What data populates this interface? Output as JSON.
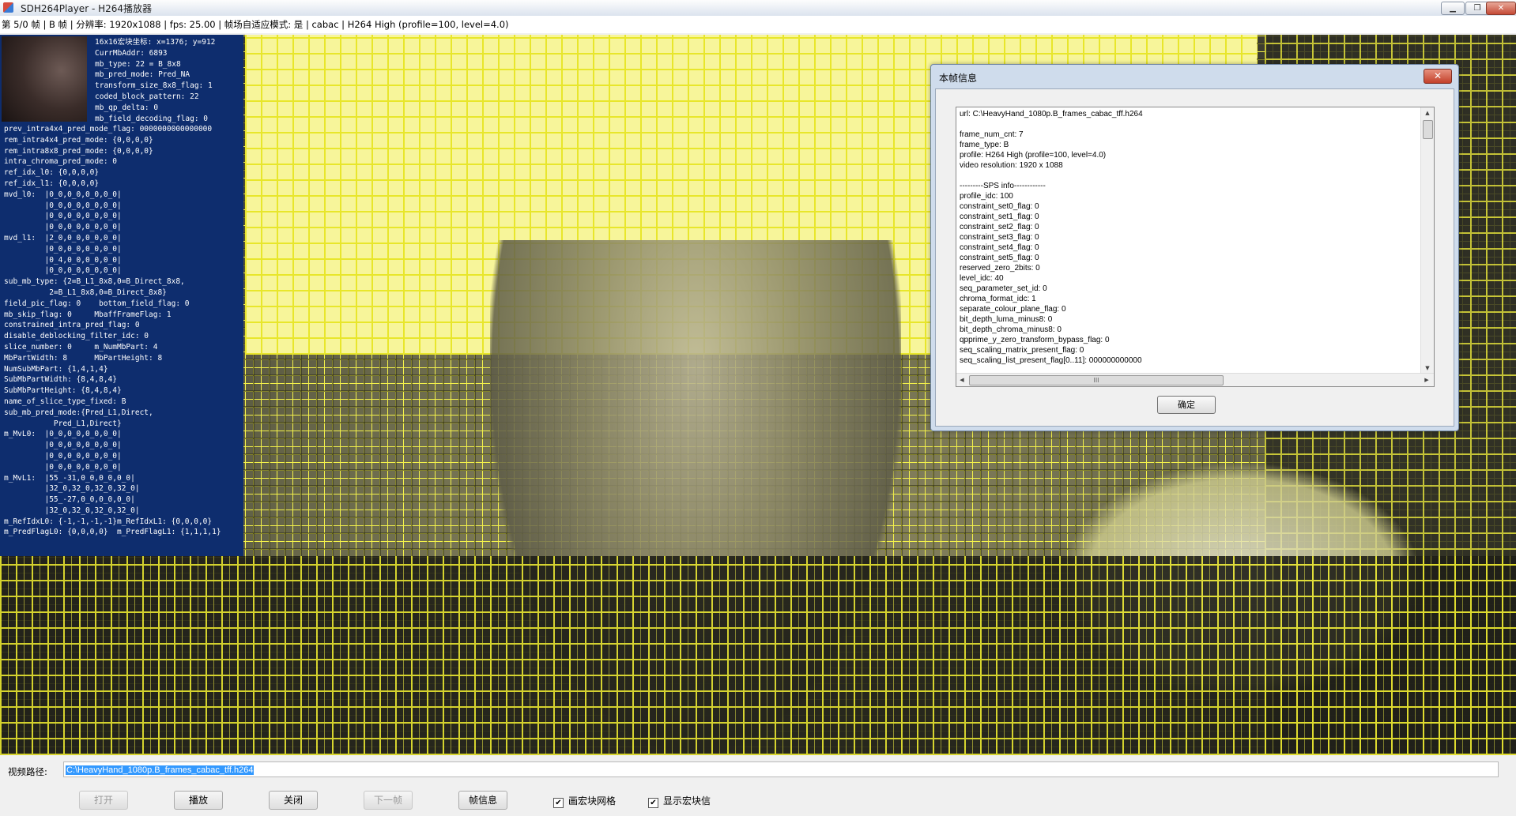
{
  "window": {
    "title": "SDH264Player - H264播放器",
    "buttons": {
      "minimize": "▁",
      "maximize": "❐",
      "close": "✕"
    }
  },
  "info_line": "第 5/0 帧 | B 帧 | 分辨率: 1920x1088 | fps: 25.00 | 帧场自适应模式: 是 | cabac | H264 High (profile=100, level=4.0)",
  "mb_panel": {
    "header": "16x16宏块坐标: x=1376; y=912\nCurrMbAddr: 6893\nmb_type: 22 = B_8x8\nmb_pred_mode: Pred_NA\ntransform_size_8x8_flag: 1\ncoded_block_pattern: 22\nmb_qp_delta: 0\nmb_field_decoding_flag: 0",
    "body": "prev_intra4x4_pred_mode_flag: 0000000000000000\nrem_intra4x4_pred_mode: {0,0,0,0}\nrem_intra8x8_pred_mode: {0,0,0,0}\nintra_chroma_pred_mode: 0\nref_idx_l0: {0,0,0,0}\nref_idx_l1: {0,0,0,0}\nmvd_l0:  |0_0,0_0,0_0,0_0|\n         |0_0,0_0,0_0,0_0|\n         |0_0,0_0,0_0,0_0|\n         |0_0,0_0,0_0,0_0|\nmvd_l1:  |2_0,0_0,0_0,0_0|\n         |0_0,0_0,0_0,0_0|\n         |0_4,0_0,0_0,0_0|\n         |0_0,0_0,0_0,0_0|\nsub_mb_type: {2=B_L1_8x8,0=B_Direct_8x8,\n          2=B_L1_8x8,0=B_Direct_8x8}\nfield_pic_flag: 0    bottom_field_flag: 0\nmb_skip_flag: 0     MbaffFrameFlag: 1\nconstrained_intra_pred_flag: 0\ndisable_deblocking_filter_idc: 0\nslice_number: 0     m_NumMbPart: 4\nMbPartWidth: 8      MbPartHeight: 8\nNumSubMbPart: {1,4,1,4}\nSubMbPartWidth: {8,4,8,4}\nSubMbPartHeight: {8,4,8,4}\nname_of_slice_type_fixed: B\nsub_mb_pred_mode:{Pred_L1,Direct,\n           Pred_L1,Direct}\nm_MvL0:  |0_0,0_0,0_0,0_0|\n         |0_0,0_0,0_0,0_0|\n         |0_0,0_0,0_0,0_0|\n         |0_0,0_0,0_0,0_0|\nm_MvL1:  |55_-31,0_0,0_0,0_0|\n         |32_0,32_0,32_0,32_0|\n         |55_-27,0_0,0_0,0_0|\n         |32_0,32_0,32_0,32_0|\nm_RefIdxL0: {-1,-1,-1,-1}m_RefIdxL1: {0,0,0,0}\nm_PredFlagL0: {0,0,0,0}  m_PredFlagL1: {1,1,1,1}"
  },
  "dialog": {
    "title": "本帧信息",
    "close_label": "✕",
    "content": "url: C:\\HeavyHand_1080p.B_frames_cabac_tff.h264\n\nframe_num_cnt: 7\nframe_type: B\nprofile: H264 High (profile=100, level=4.0)\nvideo resolution: 1920 x 1088\n\n---------SPS info------------\nprofile_idc: 100\nconstraint_set0_flag: 0\nconstraint_set1_flag: 0\nconstraint_set2_flag: 0\nconstraint_set3_flag: 0\nconstraint_set4_flag: 0\nconstraint_set5_flag: 0\nreserved_zero_2bits: 0\nlevel_idc: 40\nseq_parameter_set_id: 0\nchroma_format_idc: 1\nseparate_colour_plane_flag: 0\nbit_depth_luma_minus8: 0\nbit_depth_chroma_minus8: 0\nqpprime_y_zero_transform_bypass_flag: 0\nseq_scaling_matrix_present_flag: 0\nseq_scaling_list_present_flag[0..11]: 000000000000",
    "scroll_grip": "III",
    "ok_label": "确定"
  },
  "bottom": {
    "path_label": "视频路径:",
    "path_value": "C:\\HeavyHand_1080p.B_frames_cabac_tff.h264",
    "buttons": {
      "open": "打开",
      "play": "播放",
      "close": "关闭",
      "next_frame": "下一帧",
      "frame_info": "帧信息"
    },
    "checkboxes": {
      "draw_grid": {
        "label": "画宏块网格",
        "checked": true,
        "mark": "✔"
      },
      "show_mb_info": {
        "label": "显示宏块信",
        "checked": true,
        "mark": "✔"
      }
    }
  }
}
